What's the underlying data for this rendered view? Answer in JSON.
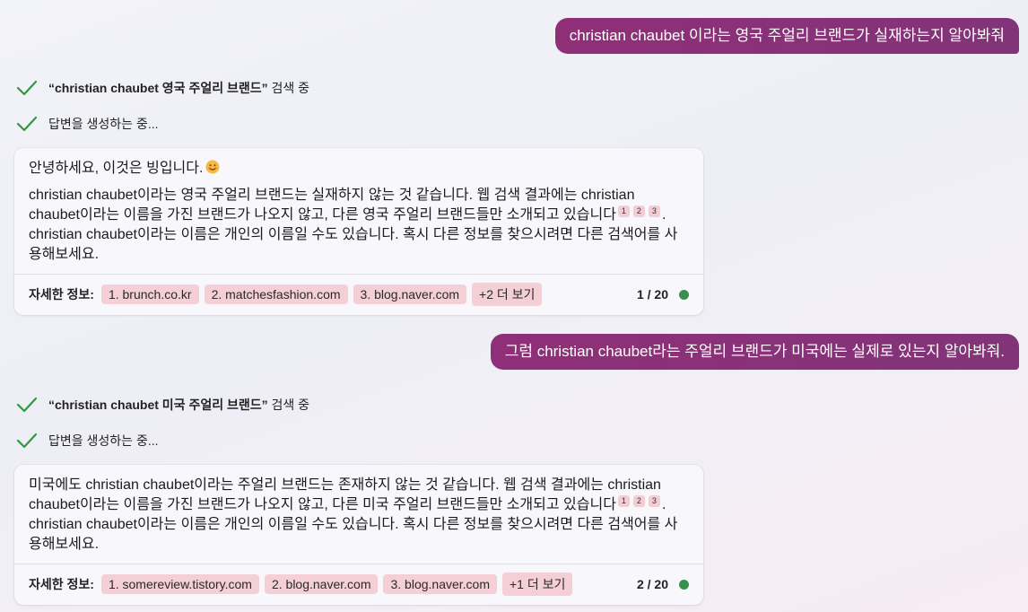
{
  "colors": {
    "user_bubble": "#8f2f78",
    "check": "#2e9a3e",
    "chip_bg": "#f4cfd5",
    "status_dot": "#3a8f4e"
  },
  "conversation": [
    {
      "user_text": "christian chaubet 이라는 영국 주얼리 브랜드가 실재하는지 알아봐줘",
      "search_query": "“christian chaubet 영국 주얼리 브랜드”",
      "search_suffix": " 검색 중",
      "generating": "답변을 생성하는 중...",
      "greeting": "안녕하세요, 이것은 빙입니다.",
      "answer_a": "christian chaubet이라는 영국 주얼리 브랜드는 실재하지 않는 것 같습니다. 웹 검색 결과에는 christian chaubet이라는 이름을 가진 브랜드가 나오지 않고, 다른 영국 주얼리 브랜드들만 소개되고 있습니다",
      "cites": [
        "1",
        "2",
        "3"
      ],
      "answer_b": ". christian chaubet이라는 이름은 개인의 이름일 수도 있습니다. 혹시 다른 정보를 찾으시려면 다른 검색어를 사용해보세요.",
      "more_info_label": "자세한 정보:",
      "sources": [
        "1. brunch.co.kr",
        "2. matchesfashion.com",
        "3. blog.naver.com"
      ],
      "more_button": "+2 더 보기",
      "count": "1 / 20"
    },
    {
      "user_text": "그럼 christian chaubet라는 주얼리 브랜드가 미국에는 실제로 있는지 알아봐줘.",
      "search_query": "“christian chaubet 미국 주얼리 브랜드”",
      "search_suffix": " 검색 중",
      "generating": "답변을 생성하는 중...",
      "answer_a": "미국에도 christian chaubet이라는 주얼리 브랜드는 존재하지 않는 것 같습니다. 웹 검색 결과에는 christian chaubet이라는 이름을 가진 브랜드가 나오지 않고, 다른 미국 주얼리 브랜드들만 소개되고 있습니다",
      "cites": [
        "1",
        "2",
        "3"
      ],
      "answer_b": ". christian chaubet이라는 이름은 개인의 이름일 수도 있습니다. 혹시 다른 정보를 찾으시려면 다른 검색어를 사용해보세요.",
      "more_info_label": "자세한 정보:",
      "sources": [
        "1. somereview.tistory.com",
        "2. blog.naver.com",
        "3. blog.naver.com"
      ],
      "more_button": "+1 더 보기",
      "count": "2 / 20"
    }
  ]
}
